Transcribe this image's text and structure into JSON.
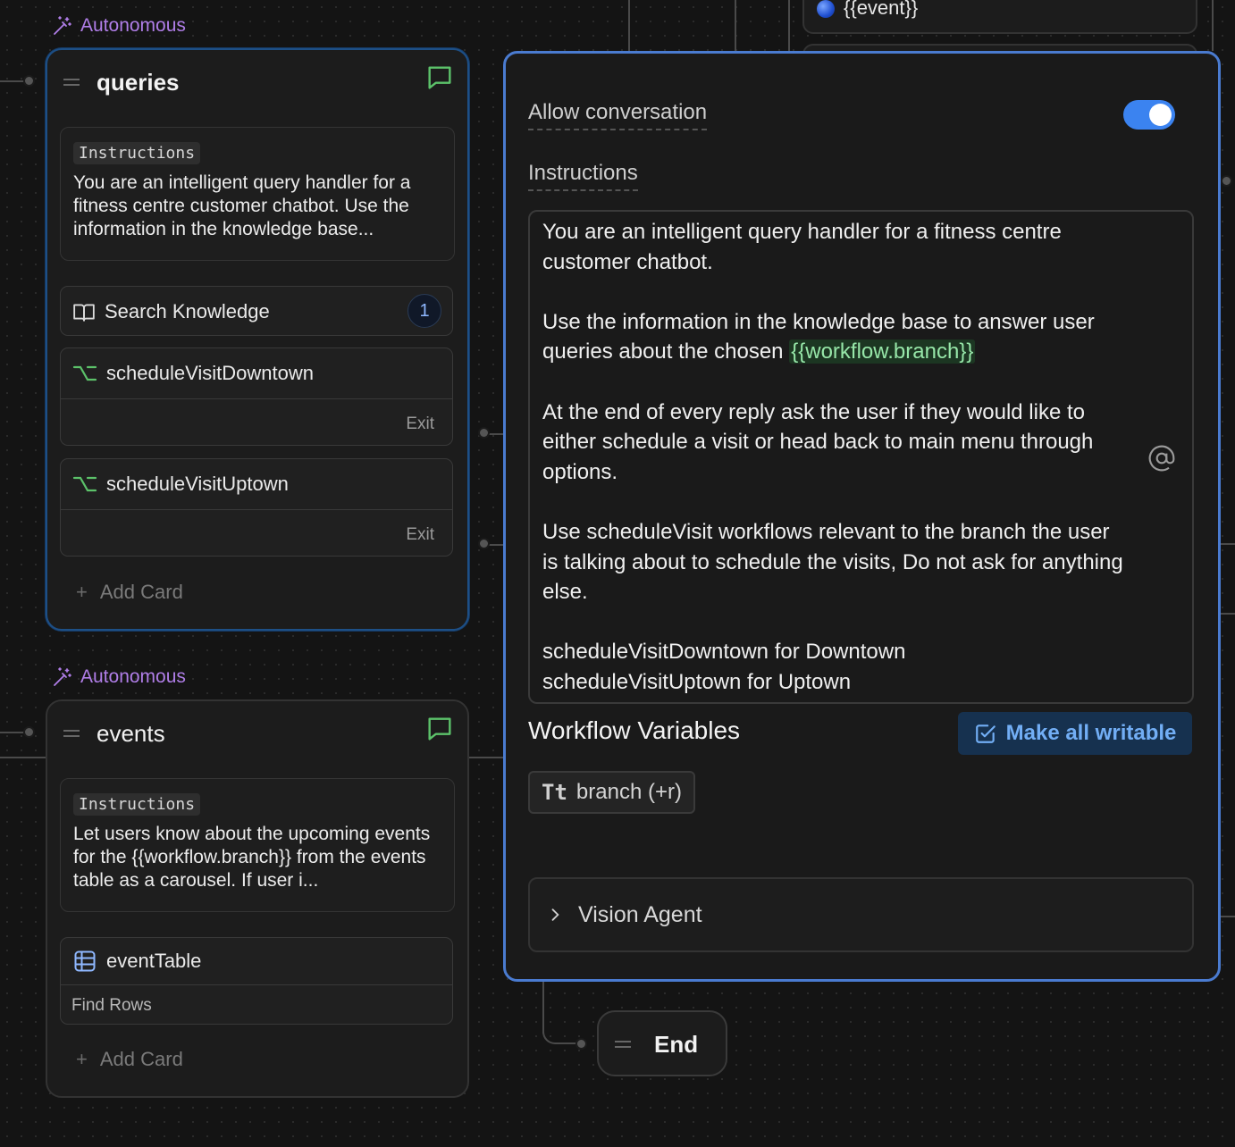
{
  "queries_node": {
    "tag": "Autonomous",
    "title": "queries",
    "instructions_label": "Instructions",
    "instructions_preview": "You are an intelligent query handler for a fitness centre customer chatbot. Use the information in the knowledge base...",
    "cards": [
      {
        "label": "Search Knowledge",
        "badge": "1",
        "icon": "book-icon"
      },
      {
        "label": "scheduleVisitDowntown",
        "footer": "Exit",
        "icon": "branch-icon"
      },
      {
        "label": "scheduleVisitUptown",
        "footer": "Exit",
        "icon": "branch-icon"
      }
    ],
    "add_card": "Add Card"
  },
  "events_node": {
    "tag": "Autonomous",
    "title": "events",
    "instructions_label": "Instructions",
    "instructions_preview": "Let users know about the upcoming events for the {{workflow.branch}} from the events table as a carousel. If user i...",
    "cards": [
      {
        "label": "eventTable",
        "footer": "Find Rows",
        "icon": "table-icon"
      }
    ],
    "add_card": "Add Card"
  },
  "panel": {
    "allow_conversation_label": "Allow conversation",
    "allow_conversation_on": true,
    "instructions_label": "Instructions",
    "instructions": {
      "p1": "You are an intelligent query handler for a fitness centre customer chatbot.",
      "p2_before": "Use the information in the knowledge base to answer user queries about the chosen ",
      "p2_var": "{{workflow.branch}}",
      "p3": "At the end of every reply ask the user if they would like to either schedule a visit or head back to main menu through options.",
      "p4": "Use scheduleVisit workflows relevant to the branch the user is talking about to schedule the visits, Do not ask for anything else.",
      "p5_line1": "scheduleVisitDowntown for Downtown",
      "p5_line2": "scheduleVisitUptown for Uptown"
    },
    "workflow_variables_title": "Workflow Variables",
    "make_all_writable": "Make all writable",
    "variable_chip": {
      "type_glyph": "Tt",
      "label": "branch (+r)"
    },
    "vision_agent": "Vision Agent"
  },
  "end_node": {
    "title": "End"
  },
  "top_partial": {
    "event_label": "{{event}}"
  },
  "colors": {
    "accent": "#3b83f0",
    "autonomous": "#b07ee8",
    "chat_icon": "#5cc26a",
    "variable_highlight": "#96e6a8"
  }
}
